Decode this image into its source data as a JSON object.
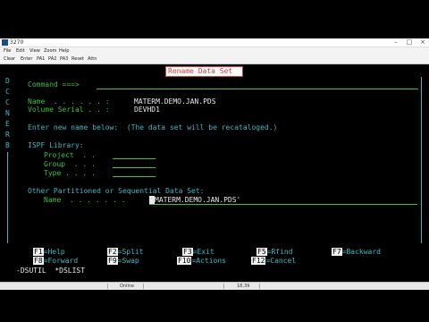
{
  "window": {
    "title": "3270",
    "controls": {
      "minimize": "–",
      "maximize": "□",
      "close": "×"
    }
  },
  "menu": [
    "File",
    "Edit",
    "View",
    "Zoom",
    "Help"
  ],
  "toolbar": [
    "Clear",
    "Enter",
    "PA1",
    "PA2",
    "PA3",
    "Reset",
    "Attn"
  ],
  "panel": {
    "title": "Rename Data Set",
    "command_label": "Command ===>",
    "command_value": "",
    "name_label": "Name  . . . . . . :",
    "name_value": "MATERM.DEMO.JAN.PDS",
    "volume_label": "Volume Serial . . :",
    "volume_value": "DEVHD1",
    "instruction": "Enter new name below:  (The data set will be recataloged.)",
    "ispf_header": "ISPF Library:",
    "project_label": "Project  . .",
    "group_label": "Group  . . .",
    "type_label": "Type . . . .",
    "other_header": "Other Partitioned or Sequential Data Set:",
    "new_name_label": "Name  . . . . . . .",
    "new_name_value": "MATERM.DEMO.JAN.PDS'"
  },
  "left_margin": [
    "D",
    "C",
    "C",
    "N",
    "E",
    "R",
    "B"
  ],
  "function_keys": [
    {
      "key": "F1",
      "label": "=Help"
    },
    {
      "key": "F2",
      "label": "=Split"
    },
    {
      "key": "F3",
      "label": "=Exit"
    },
    {
      "key": "F5",
      "label": "=Rfind"
    },
    {
      "key": "F7",
      "label": "=Backward"
    },
    {
      "key": "F8",
      "label": "=Forward"
    },
    {
      "key": "F9",
      "label": "=Swap"
    },
    {
      "key": "F10",
      "label": "=Actions"
    },
    {
      "key": "F12",
      "label": "=Cancel"
    }
  ],
  "bottom_line": "-DSUTIL  *DSLIST",
  "status": {
    "mode": "Online",
    "position": "18,39"
  },
  "colors": {
    "green": "#3fbf3f",
    "teal": "#3fb8c2",
    "blue": "#5a78e0",
    "red": "#d23a3a"
  }
}
